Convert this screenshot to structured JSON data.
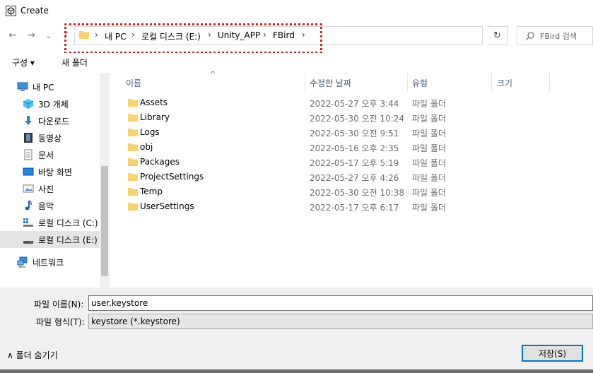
{
  "window": {
    "title": "Create"
  },
  "nav": {
    "back_glyph": "←",
    "forward_glyph": "→",
    "recent_glyph": "⌄",
    "up_glyph": "↑",
    "refresh_glyph": "↻"
  },
  "address": {
    "crumbs": [
      "내 PC",
      "로컬 디스크 (E:)",
      "Unity_APP",
      "FBird"
    ],
    "separator": "›"
  },
  "search": {
    "placeholder": "FBird 검색"
  },
  "toolbar": {
    "organize_label": "구성 ▾",
    "new_folder_label": "새 폴더"
  },
  "navpane": {
    "items": [
      {
        "label": "내 PC",
        "icon": "pc-icon"
      },
      {
        "label": "3D 개체",
        "icon": "3d-objects-icon"
      },
      {
        "label": "다운로드",
        "icon": "download-icon"
      },
      {
        "label": "동영상",
        "icon": "video-icon"
      },
      {
        "label": "문서",
        "icon": "document-icon"
      },
      {
        "label": "바탕 화면",
        "icon": "desktop-icon"
      },
      {
        "label": "사진",
        "icon": "pictures-icon"
      },
      {
        "label": "음악",
        "icon": "music-icon"
      },
      {
        "label": "로컬 디스크 (C:)",
        "icon": "drive-icon"
      },
      {
        "label": "로컬 디스크 (E:)",
        "icon": "drive-icon"
      },
      {
        "label": "네트워크",
        "icon": "network-icon"
      }
    ]
  },
  "filelist": {
    "sort_glyph": "^",
    "columns": {
      "name": "이름",
      "date": "수정한 날짜",
      "type": "유형",
      "size": "크기"
    },
    "rows": [
      {
        "name": "Assets",
        "date": "2022-05-27 오후 3:44",
        "type": "파일 폴더"
      },
      {
        "name": "Library",
        "date": "2022-05-30 오전 10:24",
        "type": "파일 폴더"
      },
      {
        "name": "Logs",
        "date": "2022-05-30 오전 9:51",
        "type": "파일 폴더"
      },
      {
        "name": "obj",
        "date": "2022-05-16 오후 2:35",
        "type": "파일 폴더"
      },
      {
        "name": "Packages",
        "date": "2022-05-17 오후 5:19",
        "type": "파일 폴더"
      },
      {
        "name": "ProjectSettings",
        "date": "2022-05-27 오후 4:26",
        "type": "파일 폴더"
      },
      {
        "name": "Temp",
        "date": "2022-05-30 오전 10:38",
        "type": "파일 폴더"
      },
      {
        "name": "UserSettings",
        "date": "2022-05-17 오후 6:17",
        "type": "파일 폴더"
      }
    ]
  },
  "bottom": {
    "filename_label": "파일 이름(N):",
    "filename_value": "user.keystore",
    "filetype_label": "파일 형식(T):",
    "filetype_value": "keystore (*.keystore)",
    "hide_folders_label": "∧  폴더 숨기기",
    "save_label": "저장(S)"
  },
  "colors": {
    "folder": "#f6d36b",
    "accent": "#0078d7",
    "highlight": "#d42020"
  }
}
